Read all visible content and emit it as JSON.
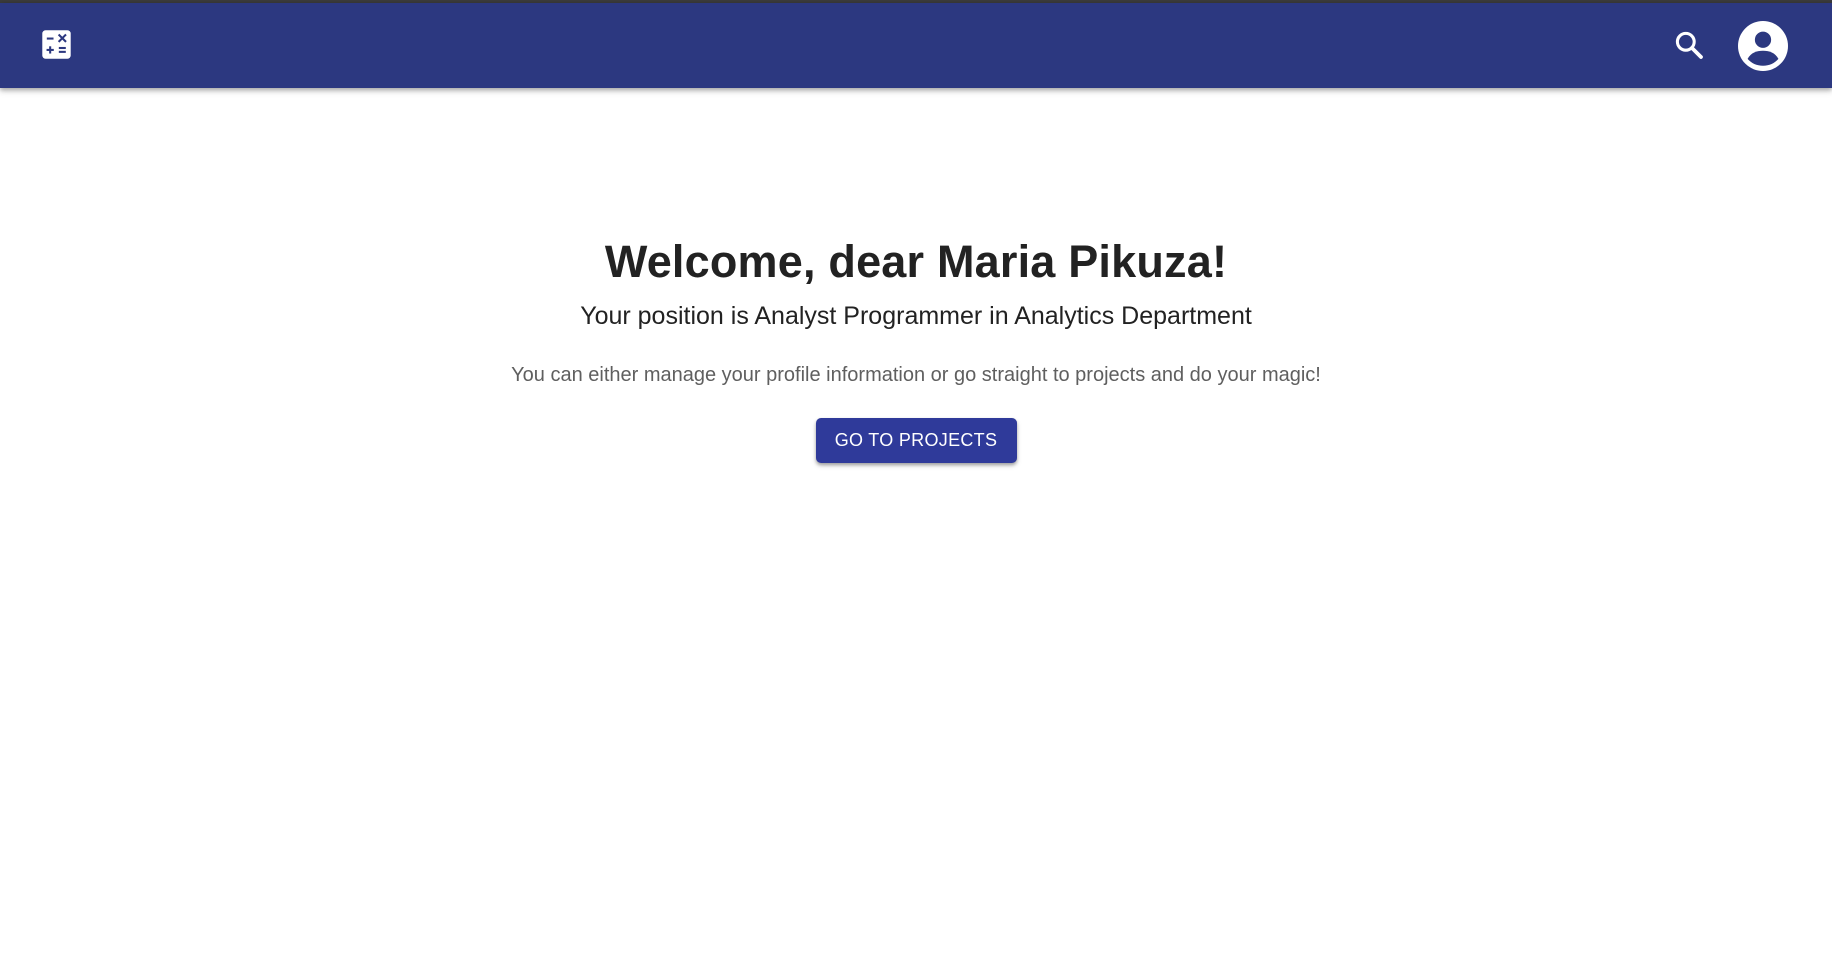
{
  "header": {
    "logo_icon": "calculator-icon",
    "search_icon": "search-icon",
    "account_icon": "account-circle-icon",
    "background_color": "#2c3880"
  },
  "main": {
    "title": "Welcome, dear Maria Pikuza!",
    "position_text": "Your position is Analyst Programmer in Analytics Department",
    "info_text": "You can either manage your profile information or go straight to projects and do your magic!",
    "cta_label": "GO TO PROJECTS",
    "cta_color": "#2f3a9a"
  }
}
